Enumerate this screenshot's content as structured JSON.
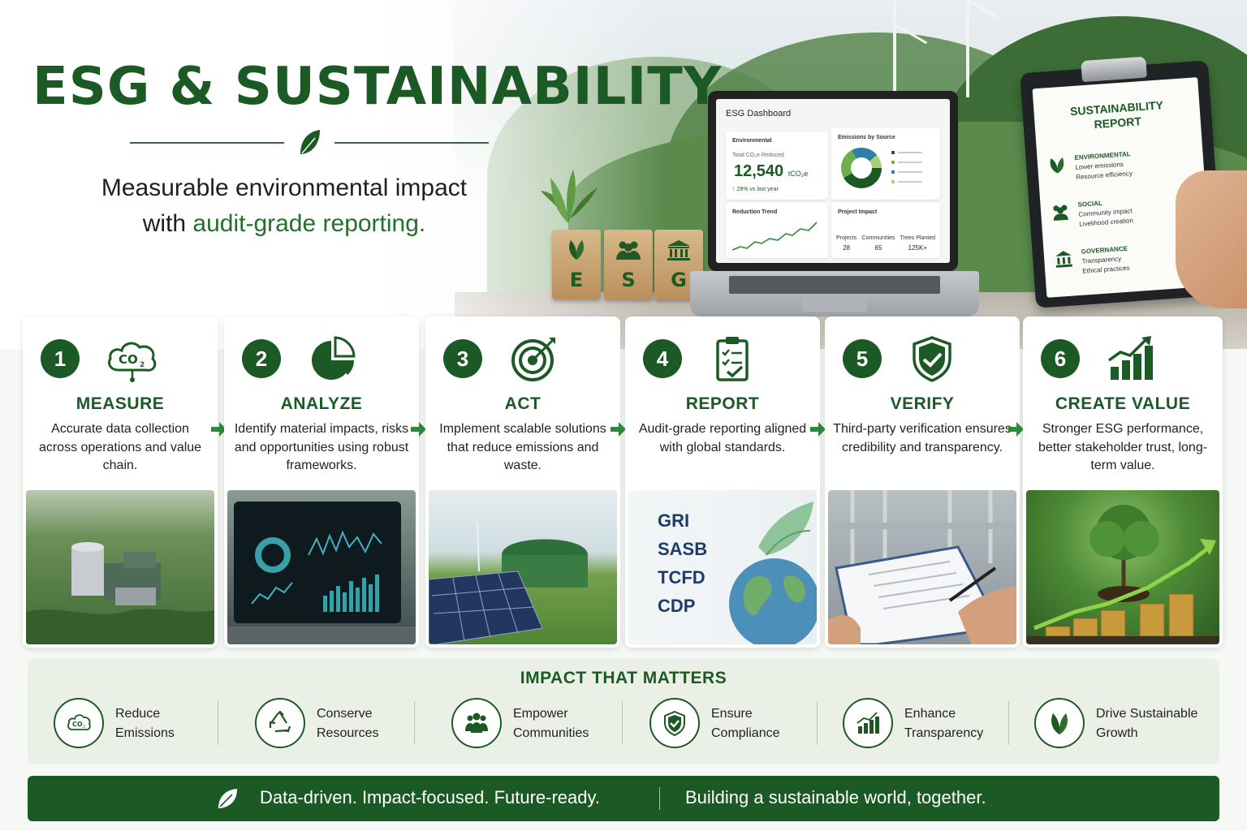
{
  "hero": {
    "title": "ESG & SUSTAINABILITY",
    "subtitle_line1": "Measurable environmental impact",
    "subtitle_line2_prefix": "with ",
    "subtitle_line2_highlight": "audit-grade reporting.",
    "blocks": [
      "E",
      "S",
      "G"
    ]
  },
  "dashboard": {
    "title": "ESG Dashboard",
    "env_label": "Environmental",
    "total_label": "Total CO₂e Reduced",
    "total_value": "12,540",
    "total_unit": "tCO₂e",
    "change": "↑ 28% vs last year",
    "emissions_label": "Emissions by Source",
    "trend_label": "Reduction Trend",
    "project_label": "Project Impact",
    "stats": [
      {
        "label": "Projects",
        "value": "28"
      },
      {
        "label": "Communities",
        "value": "65"
      },
      {
        "label": "Trees Planted",
        "value": "125K+"
      }
    ]
  },
  "report": {
    "title_line1": "SUSTAINABILITY",
    "title_line2": "REPORT",
    "rows": [
      {
        "heading": "ENVIRONMENTAL",
        "l1": "Lower emissions",
        "l2": "Resource efficiency",
        "icon": "leaf-icon"
      },
      {
        "heading": "SOCIAL",
        "l1": "Community impact",
        "l2": "Livelihood creation",
        "icon": "people-icon"
      },
      {
        "heading": "GOVERNANCE",
        "l1": "Transparency",
        "l2": "Ethical practices",
        "icon": "institution-icon"
      }
    ]
  },
  "steps": [
    {
      "num": "1",
      "title": "MEASURE",
      "desc": "Accurate data collection across operations and value chain.",
      "icon": "co2-cloud-icon"
    },
    {
      "num": "2",
      "title": "ANALYZE",
      "desc": "Identify material impacts, risks and opportunities using robust frameworks.",
      "icon": "pie-chart-icon"
    },
    {
      "num": "3",
      "title": "ACT",
      "desc": "Implement scalable solutions that reduce emissions and waste.",
      "icon": "target-icon"
    },
    {
      "num": "4",
      "title": "REPORT",
      "desc": "Audit-grade reporting aligned with global standards.",
      "icon": "clipboard-check-icon"
    },
    {
      "num": "5",
      "title": "VERIFY",
      "desc": "Third-party verification ensures credibility and transparency.",
      "icon": "shield-check-icon"
    },
    {
      "num": "6",
      "title": "CREATE VALUE",
      "desc": "Stronger ESG performance, better stakeholder trust, long-term value.",
      "icon": "growth-chart-icon"
    }
  ],
  "frameworks": [
    "GRI",
    "SASB",
    "TCFD",
    "CDP"
  ],
  "impact": {
    "title": "IMPACT THAT MATTERS",
    "items": [
      {
        "l1": "Reduce",
        "l2": "Emissions",
        "icon": "co2-cloud-icon"
      },
      {
        "l1": "Conserve",
        "l2": "Resources",
        "icon": "recycle-icon"
      },
      {
        "l1": "Empower",
        "l2": "Communities",
        "icon": "people-icon"
      },
      {
        "l1": "Ensure",
        "l2": "Compliance",
        "icon": "shield-check-icon"
      },
      {
        "l1": "Enhance",
        "l2": "Transparency",
        "icon": "bar-chart-icon"
      },
      {
        "l1": "Drive Sustainable",
        "l2": "Growth",
        "icon": "leaf-icon"
      }
    ]
  },
  "footer": {
    "left": "Data-driven. Impact-focused. Future-ready.",
    "right": "Building a sustainable world, together."
  },
  "colors": {
    "brand_green": "#1c5a25",
    "accent_green": "#23702c",
    "panel_bg": "#eaf0e6"
  }
}
